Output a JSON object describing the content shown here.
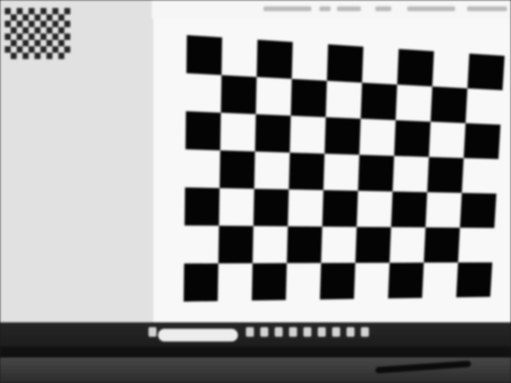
{
  "photo": {
    "subject": "calibration-checkerboard-on-monitor",
    "colors": {
      "square_dark": "#0a0a0a",
      "square_light": "#f3f3f3",
      "screen_bg": "#e8e8e8",
      "bezel": "#151515"
    }
  },
  "taskbar": {
    "search_icon": "search-icon"
  }
}
